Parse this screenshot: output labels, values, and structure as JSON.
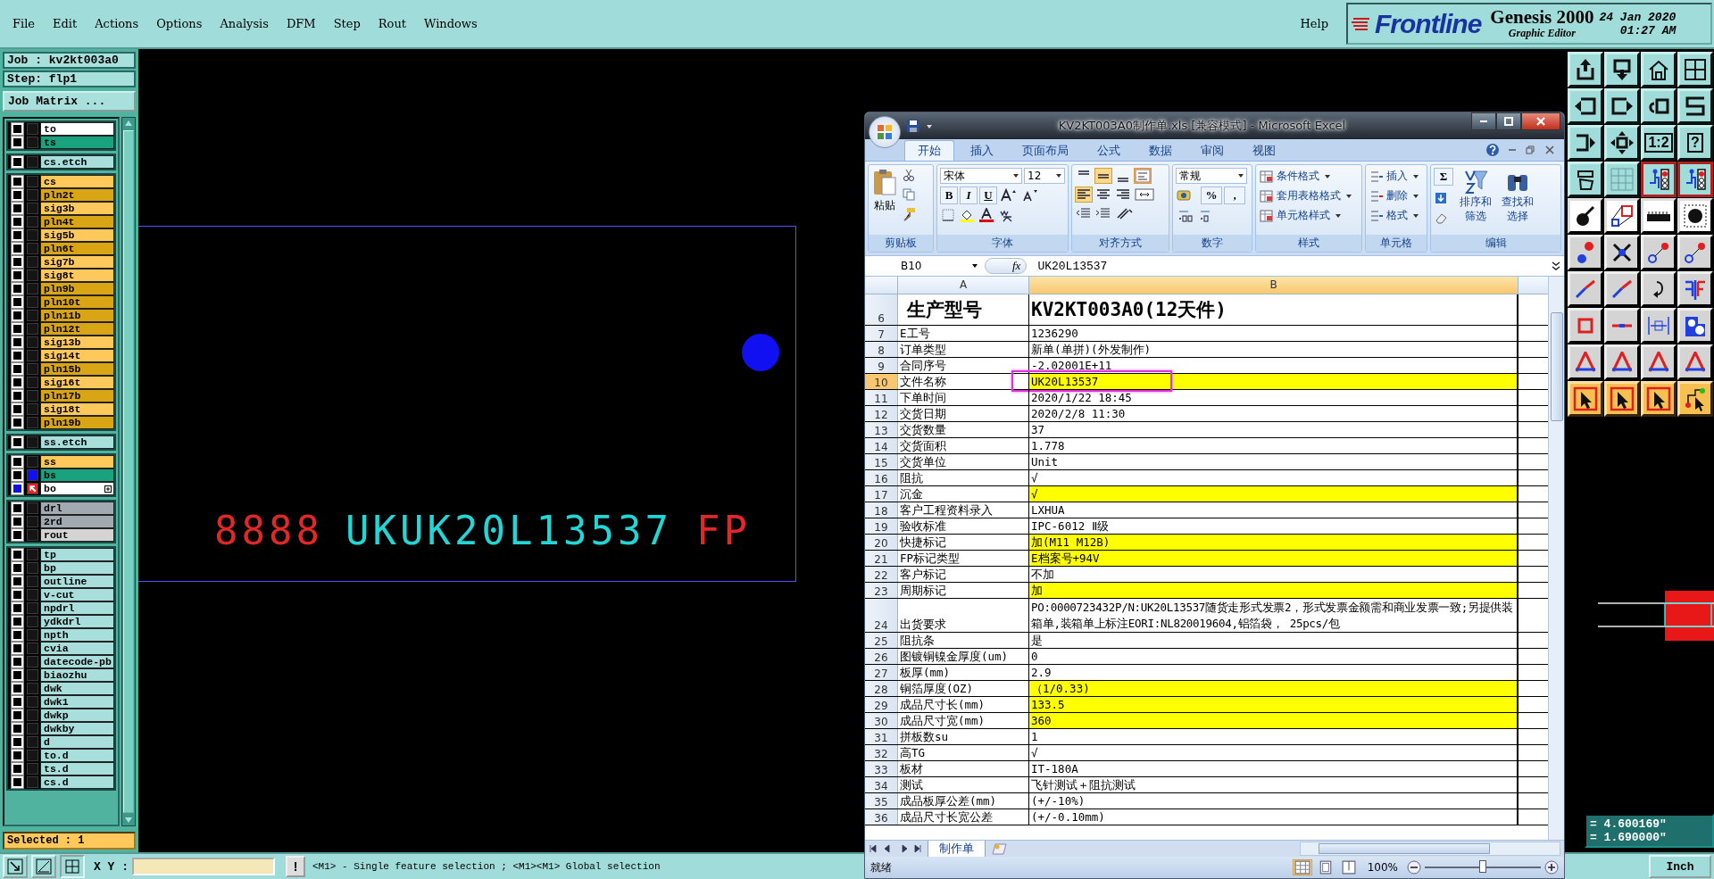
{
  "menu": {
    "items": [
      "File",
      "Edit",
      "Actions",
      "Options",
      "Analysis",
      "DFM",
      "Step",
      "Rout",
      "Windows"
    ],
    "help": "Help"
  },
  "brand": {
    "logo": "Frontline",
    "product": "Genesis 2000",
    "subtitle": "Graphic Editor",
    "date": "24 Jan 2020",
    "time": "01:27 AM"
  },
  "job": {
    "job": "Job : kv2kt003a0",
    "step": "Step: flp1",
    "matrix_button": "Job Matrix ..."
  },
  "layer_groups": [
    [
      {
        "name": "to",
        "color": "#ffffff",
        "active": false,
        "affected": false,
        "work": false
      },
      {
        "name": "ts",
        "color": "#1aa27e",
        "active": false,
        "affected": false,
        "work": false
      }
    ],
    [
      {
        "name": "cs.etch",
        "color": "#a8dedb",
        "active": false,
        "affected": false,
        "work": false
      }
    ],
    [
      {
        "name": "cs",
        "color": "#ffc85a",
        "active": false,
        "affected": false,
        "work": false
      },
      {
        "name": "pln2t",
        "color": "#d9a514",
        "active": false,
        "affected": false,
        "work": false
      },
      {
        "name": "sig3b",
        "color": "#ffc85a",
        "active": false,
        "affected": false,
        "work": false
      },
      {
        "name": "pln4t",
        "color": "#d9a514",
        "active": false,
        "affected": false,
        "work": false
      },
      {
        "name": "sig5b",
        "color": "#ffc85a",
        "active": false,
        "affected": false,
        "work": false
      },
      {
        "name": "pln6t",
        "color": "#d9a514",
        "active": false,
        "affected": false,
        "work": false
      },
      {
        "name": "sig7b",
        "color": "#ffc85a",
        "active": false,
        "affected": false,
        "work": false
      },
      {
        "name": "sig8t",
        "color": "#ffc85a",
        "active": false,
        "affected": false,
        "work": false
      },
      {
        "name": "pln9b",
        "color": "#d9a514",
        "active": false,
        "affected": false,
        "work": false
      },
      {
        "name": "pln10t",
        "color": "#d9a514",
        "active": false,
        "affected": false,
        "work": false
      },
      {
        "name": "pln11b",
        "color": "#d9a514",
        "active": false,
        "affected": false,
        "work": false
      },
      {
        "name": "pln12t",
        "color": "#d9a514",
        "active": false,
        "affected": false,
        "work": false
      },
      {
        "name": "sig13b",
        "color": "#ffc85a",
        "active": false,
        "affected": false,
        "work": false
      },
      {
        "name": "sig14t",
        "color": "#ffc85a",
        "active": false,
        "affected": false,
        "work": false
      },
      {
        "name": "pln15b",
        "color": "#d9a514",
        "active": false,
        "affected": false,
        "work": false
      },
      {
        "name": "sig16t",
        "color": "#ffc85a",
        "active": false,
        "affected": false,
        "work": false
      },
      {
        "name": "pln17b",
        "color": "#d9a514",
        "active": false,
        "affected": false,
        "work": false
      },
      {
        "name": "sig18t",
        "color": "#ffc85a",
        "active": false,
        "affected": false,
        "work": false
      },
      {
        "name": "pln19b",
        "color": "#d9a514",
        "active": false,
        "affected": false,
        "work": false
      }
    ],
    [
      {
        "name": "ss.etch",
        "color": "#a8dedb",
        "active": false,
        "affected": false,
        "work": false
      }
    ],
    [
      {
        "name": "ss",
        "color": "#ffc85a",
        "active": false,
        "affected": false,
        "work": false
      },
      {
        "name": "bs",
        "color": "#1aa27e",
        "active": false,
        "affected": true,
        "work": false
      },
      {
        "name": "bo",
        "color": "#ffffff",
        "active": true,
        "affected": false,
        "work": true
      }
    ],
    [
      {
        "name": "drl",
        "color": "#a0aab0",
        "active": false,
        "affected": false,
        "work": false
      },
      {
        "name": "2rd",
        "color": "#a0aab0",
        "active": false,
        "affected": false,
        "work": false
      },
      {
        "name": "rout",
        "color": "#d4d4d4",
        "active": false,
        "affected": false,
        "work": false
      }
    ],
    [
      {
        "name": "tp",
        "color": "#a8dedb",
        "active": false,
        "affected": false,
        "work": false
      },
      {
        "name": "bp",
        "color": "#a8dedb",
        "active": false,
        "affected": false,
        "work": false
      },
      {
        "name": "outline",
        "color": "#a8dedb",
        "active": false,
        "affected": false,
        "work": false
      },
      {
        "name": "v-cut",
        "color": "#a8dedb",
        "active": false,
        "affected": false,
        "work": false
      },
      {
        "name": "npdrl",
        "color": "#a8dedb",
        "active": false,
        "affected": false,
        "work": false
      },
      {
        "name": "ydkdrl",
        "color": "#a8dedb",
        "active": false,
        "affected": false,
        "work": false
      },
      {
        "name": "npth",
        "color": "#a8dedb",
        "active": false,
        "affected": false,
        "work": false
      },
      {
        "name": "cvia",
        "color": "#a8dedb",
        "active": false,
        "affected": false,
        "work": false
      },
      {
        "name": "datecode-pb",
        "color": "#a8dedb",
        "active": false,
        "affected": false,
        "work": false
      },
      {
        "name": "biaozhu",
        "color": "#a8dedb",
        "active": false,
        "affected": false,
        "work": false
      },
      {
        "name": "dwk",
        "color": "#a8dedb",
        "active": false,
        "affected": false,
        "work": false
      },
      {
        "name": "dwk1",
        "color": "#a8dedb",
        "active": false,
        "affected": false,
        "work": false
      },
      {
        "name": "dwkp",
        "color": "#a8dedb",
        "active": false,
        "affected": false,
        "work": false
      },
      {
        "name": "dwkby",
        "color": "#a8dedb",
        "active": false,
        "affected": false,
        "work": false
      },
      {
        "name": "d",
        "color": "#a8dedb",
        "active": false,
        "affected": false,
        "work": false
      },
      {
        "name": "to.d",
        "color": "#a8dedb",
        "active": false,
        "affected": false,
        "work": false
      },
      {
        "name": "ts.d",
        "color": "#a8dedb",
        "active": false,
        "affected": false,
        "work": false
      },
      {
        "name": "cs.d",
        "color": "#a8dedb",
        "active": false,
        "affected": false,
        "work": false
      }
    ]
  ],
  "selected_count": "Selected : 1",
  "canvas": {
    "texts": [
      {
        "text": "8888",
        "color": "#e02828"
      },
      {
        "text": "UKUK20L13537",
        "color": "#22d6d6"
      },
      {
        "text": "FP",
        "color": "#e02828"
      }
    ]
  },
  "toolbar": {
    "ratio_label": "1:2",
    "help_label": "?"
  },
  "coordinates": [
    "= 4.600169\"",
    "= 1.690000\""
  ],
  "units_button": "Inch",
  "bottom_bar": {
    "xy_label": "X Y :",
    "alert": "!",
    "message": "<M1> - Single feature selection ; <M1><M1> Global selection"
  },
  "excel": {
    "title": "KV2KT003A0制作单.xls  [兼容模式] - Microsoft Excel",
    "tabs": [
      {
        "label": "开始",
        "selected": true
      },
      {
        "label": "插入",
        "selected": false
      },
      {
        "label": "页面布局",
        "selected": false
      },
      {
        "label": "公式",
        "selected": false
      },
      {
        "label": "数据",
        "selected": false
      },
      {
        "label": "审阅",
        "selected": false
      },
      {
        "label": "视图",
        "selected": false
      }
    ],
    "ribbon": {
      "paste": "粘贴",
      "font_name": "宋体",
      "font_size": "12",
      "format_letters": [
        "B",
        "I",
        "U"
      ],
      "number_format": "常规",
      "percent": "%",
      "comma": ",",
      "styles": [
        "条件格式",
        "套用表格格式",
        "单元格样式"
      ],
      "cells": [
        "插入",
        "删除",
        "格式"
      ],
      "sigma": "Σ",
      "sort": "排序和筛选",
      "find": "查找和选择"
    },
    "groups": [
      "剪贴板",
      "字体",
      "对齐方式",
      "数字",
      "样式",
      "单元格",
      "编辑"
    ],
    "name_box": "B10",
    "fx_label": "fx",
    "formula": "UK20L13537",
    "columns": [
      "A",
      "B"
    ],
    "rows": [
      {
        "num": "6",
        "a": "生产型号",
        "b": "KV2KT003A0(12天件)",
        "kind": "title",
        "highlight": false,
        "selected": false,
        "marked": false
      },
      {
        "num": "7",
        "a": "E工号",
        "b": "1236290",
        "kind": "normal",
        "highlight": false,
        "selected": false,
        "marked": false
      },
      {
        "num": "8",
        "a": "订单类型",
        "b": "新单(单拼)(外发制作)",
        "kind": "normal",
        "highlight": false,
        "selected": false,
        "marked": false
      },
      {
        "num": "9",
        "a": "合同序号",
        "b": "-2.02001E+11",
        "kind": "normal",
        "highlight": false,
        "selected": false,
        "marked": false
      },
      {
        "num": "10",
        "a": "文件名称",
        "b": "UK20L13537",
        "kind": "normal",
        "highlight": true,
        "selected": true,
        "marked": true
      },
      {
        "num": "11",
        "a": "下单时间",
        "b": "2020/1/22 18:45",
        "kind": "normal",
        "highlight": false,
        "selected": false,
        "marked": false
      },
      {
        "num": "12",
        "a": "交货日期",
        "b": "2020/2/8 11:30",
        "kind": "normal",
        "highlight": false,
        "selected": false,
        "marked": false
      },
      {
        "num": "13",
        "a": "交货数量",
        "b": "37",
        "kind": "normal",
        "highlight": false,
        "selected": false,
        "marked": false
      },
      {
        "num": "14",
        "a": "交货面积",
        "b": "1.778",
        "kind": "normal",
        "highlight": false,
        "selected": false,
        "marked": false
      },
      {
        "num": "15",
        "a": "交货单位",
        "b": "Unit",
        "kind": "normal",
        "highlight": false,
        "selected": false,
        "marked": false
      },
      {
        "num": "16",
        "a": "阻抗",
        "b": "√",
        "kind": "normal",
        "highlight": false,
        "selected": false,
        "marked": false
      },
      {
        "num": "17",
        "a": "沉金",
        "b": "√",
        "kind": "normal",
        "highlight": true,
        "selected": false,
        "marked": false
      },
      {
        "num": "18",
        "a": "客户工程资料录入",
        "b": "LXHUA",
        "kind": "normal",
        "highlight": false,
        "selected": false,
        "marked": false
      },
      {
        "num": "19",
        "a": "验收标准",
        "b": "IPC-6012 Ⅱ级",
        "kind": "normal",
        "highlight": false,
        "selected": false,
        "marked": false
      },
      {
        "num": "20",
        "a": "快捷标记",
        "b": "加(M11 M12B)",
        "kind": "normal",
        "highlight": true,
        "selected": false,
        "marked": false
      },
      {
        "num": "21",
        "a": "FP标记类型",
        "b": "E档案号+94V",
        "kind": "normal",
        "highlight": true,
        "selected": false,
        "marked": false
      },
      {
        "num": "22",
        "a": "客户标记",
        "b": "不加",
        "kind": "normal",
        "highlight": false,
        "selected": false,
        "marked": false
      },
      {
        "num": "23",
        "a": "周期标记",
        "b": "加",
        "kind": "normal",
        "highlight": true,
        "selected": false,
        "marked": false
      },
      {
        "num": "24",
        "a": "出货要求",
        "b": "PO:0000723432P/N:UK20L13537随货走形式发票2，形式发票金额需和商业发票一致;另提供装箱单,装箱单上标注EORI:NL820019604,铝箔袋， 25pcs/包",
        "kind": "wrap",
        "highlight": false,
        "selected": false,
        "marked": false
      },
      {
        "num": "25",
        "a": "阻抗条",
        "b": "是",
        "kind": "normal",
        "highlight": false,
        "selected": false,
        "marked": false
      },
      {
        "num": "26",
        "a": "图镀铜镍金厚度(um)",
        "b": "0",
        "kind": "normal",
        "highlight": false,
        "selected": false,
        "marked": false
      },
      {
        "num": "27",
        "a": "板厚(mm)",
        "b": "2.9",
        "kind": "normal",
        "highlight": false,
        "selected": false,
        "marked": false
      },
      {
        "num": "28",
        "a": "铜箔厚度(OZ)",
        "b": "（1/0.33)",
        "kind": "normal",
        "highlight": true,
        "selected": false,
        "marked": false
      },
      {
        "num": "29",
        "a": "成品尺寸长(mm)",
        "b": "133.5",
        "kind": "normal",
        "highlight": true,
        "selected": false,
        "marked": false
      },
      {
        "num": "30",
        "a": "成品尺寸宽(mm)",
        "b": "360",
        "kind": "normal",
        "highlight": true,
        "selected": false,
        "marked": false
      },
      {
        "num": "31",
        "a": "拼板数su",
        "b": "1",
        "kind": "normal",
        "highlight": false,
        "selected": false,
        "marked": false
      },
      {
        "num": "32",
        "a": "高TG",
        "b": "√",
        "kind": "normal",
        "highlight": false,
        "selected": false,
        "marked": false
      },
      {
        "num": "33",
        "a": "板材",
        "b": "IT-180A",
        "kind": "normal",
        "highlight": false,
        "selected": false,
        "marked": false
      },
      {
        "num": "34",
        "a": "测试",
        "b": "飞针测试＋阻抗测试",
        "kind": "normal",
        "highlight": false,
        "selected": false,
        "marked": false
      },
      {
        "num": "35",
        "a": "成品板厚公差(mm)",
        "b": "(+/-10%)",
        "kind": "normal",
        "highlight": false,
        "selected": false,
        "marked": false
      },
      {
        "num": "36",
        "a": "成品尺寸长宽公差",
        "b": "(+/-0.10mm)",
        "kind": "normal",
        "highlight": false,
        "selected": false,
        "marked": false
      }
    ],
    "sheet_tab": "制作单",
    "status": "就绪",
    "zoom": "100%",
    "zoom_slider": {
      "level": 0.5
    }
  }
}
